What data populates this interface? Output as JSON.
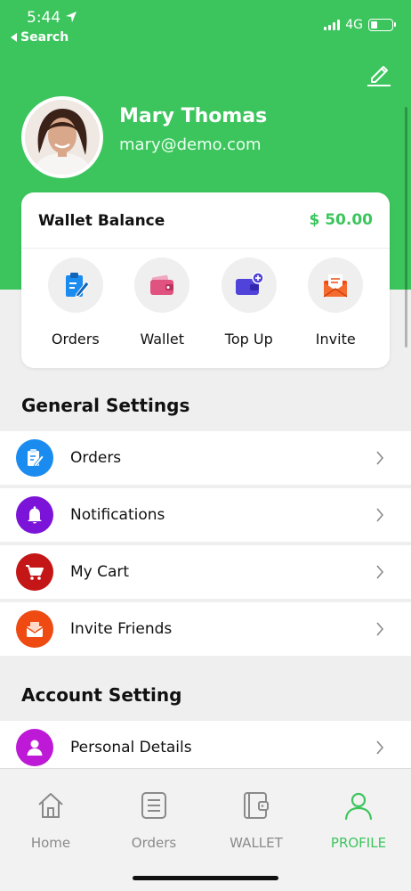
{
  "status_bar": {
    "time": "5:44",
    "back_label": "Search",
    "network": "4G"
  },
  "profile": {
    "name": "Mary Thomas",
    "email": "mary@demo.com"
  },
  "wallet": {
    "title": "Wallet Balance",
    "amount": "$ 50.00",
    "actions": [
      {
        "label": "Orders",
        "icon": "orders-clipboard-icon"
      },
      {
        "label": "Wallet",
        "icon": "wallet-icon"
      },
      {
        "label": "Top Up",
        "icon": "top-up-card-icon"
      },
      {
        "label": "Invite",
        "icon": "invite-envelope-icon"
      }
    ]
  },
  "general_settings": {
    "title": "General Settings",
    "items": [
      {
        "label": "Orders",
        "icon": "orders-icon",
        "color": "#1a8cf0"
      },
      {
        "label": "Notifications",
        "icon": "bell-icon",
        "color": "#7b13d9"
      },
      {
        "label": "My Cart",
        "icon": "cart-icon",
        "color": "#c41616"
      },
      {
        "label": "Invite Friends",
        "icon": "invite-icon",
        "color": "#ee4a12"
      }
    ]
  },
  "account_setting": {
    "title": "Account Setting",
    "items": [
      {
        "label": "Personal Details",
        "icon": "person-icon",
        "color": "#bd19d6"
      }
    ]
  },
  "tabs": [
    {
      "label": "Home",
      "icon": "home-icon",
      "active": false
    },
    {
      "label": "Orders",
      "icon": "orders-list-icon",
      "active": false
    },
    {
      "label": "WALLET",
      "icon": "wallet-icon",
      "active": false
    },
    {
      "label": "PROFILE",
      "icon": "profile-icon",
      "active": true
    }
  ],
  "colors": {
    "brand_green": "#3cc55d",
    "background": "#efefef"
  }
}
